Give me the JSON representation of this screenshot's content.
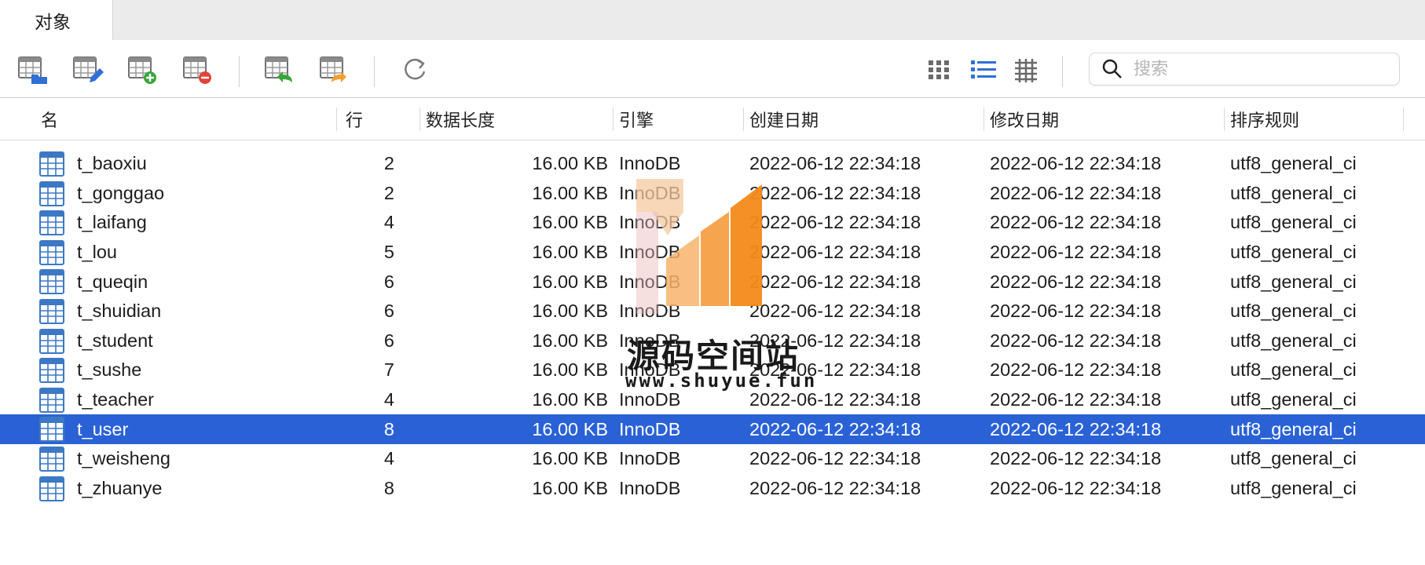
{
  "tabs": [
    {
      "label": "对象",
      "active": true
    }
  ],
  "toolbar": {
    "buttons": [
      "open-table-icon",
      "design-table-icon",
      "new-table-icon",
      "delete-table-icon",
      "import-wizard-icon",
      "export-wizard-icon",
      "refresh-icon"
    ],
    "views": [
      "grid-view-icon",
      "list-view-icon",
      "detail-view-icon"
    ],
    "search_placeholder": "搜索",
    "search_value": ""
  },
  "columns": [
    "名",
    "行",
    "数据长度",
    "引擎",
    "创建日期",
    "修改日期",
    "排序规则"
  ],
  "rows": [
    {
      "name": "t_baoxiu",
      "rows": "2",
      "length": "16.00 KB",
      "engine": "InnoDB",
      "created": "2022-06-12 22:34:18",
      "modified": "2022-06-12 22:34:18",
      "collation": "utf8_general_ci"
    },
    {
      "name": "t_gonggao",
      "rows": "2",
      "length": "16.00 KB",
      "engine": "InnoDB",
      "created": "2022-06-12 22:34:18",
      "modified": "2022-06-12 22:34:18",
      "collation": "utf8_general_ci"
    },
    {
      "name": "t_laifang",
      "rows": "4",
      "length": "16.00 KB",
      "engine": "InnoDB",
      "created": "2022-06-12 22:34:18",
      "modified": "2022-06-12 22:34:18",
      "collation": "utf8_general_ci"
    },
    {
      "name": "t_lou",
      "rows": "5",
      "length": "16.00 KB",
      "engine": "InnoDB",
      "created": "2022-06-12 22:34:18",
      "modified": "2022-06-12 22:34:18",
      "collation": "utf8_general_ci"
    },
    {
      "name": "t_queqin",
      "rows": "6",
      "length": "16.00 KB",
      "engine": "InnoDB",
      "created": "2022-06-12 22:34:18",
      "modified": "2022-06-12 22:34:18",
      "collation": "utf8_general_ci"
    },
    {
      "name": "t_shuidian",
      "rows": "6",
      "length": "16.00 KB",
      "engine": "InnoDB",
      "created": "2022-06-12 22:34:18",
      "modified": "2022-06-12 22:34:18",
      "collation": "utf8_general_ci"
    },
    {
      "name": "t_student",
      "rows": "6",
      "length": "16.00 KB",
      "engine": "InnoDB",
      "created": "2022-06-12 22:34:18",
      "modified": "2022-06-12 22:34:18",
      "collation": "utf8_general_ci"
    },
    {
      "name": "t_sushe",
      "rows": "7",
      "length": "16.00 KB",
      "engine": "InnoDB",
      "created": "2022-06-12 22:34:18",
      "modified": "2022-06-12 22:34:18",
      "collation": "utf8_general_ci"
    },
    {
      "name": "t_teacher",
      "rows": "4",
      "length": "16.00 KB",
      "engine": "InnoDB",
      "created": "2022-06-12 22:34:18",
      "modified": "2022-06-12 22:34:18",
      "collation": "utf8_general_ci"
    },
    {
      "name": "t_user",
      "rows": "8",
      "length": "16.00 KB",
      "engine": "InnoDB",
      "created": "2022-06-12 22:34:18",
      "modified": "2022-06-12 22:34:18",
      "collation": "utf8_general_ci"
    },
    {
      "name": "t_weisheng",
      "rows": "4",
      "length": "16.00 KB",
      "engine": "InnoDB",
      "created": "2022-06-12 22:34:18",
      "modified": "2022-06-12 22:34:18",
      "collation": "utf8_general_ci"
    },
    {
      "name": "t_zhuanye",
      "rows": "8",
      "length": "16.00 KB",
      "engine": "InnoDB",
      "created": "2022-06-12 22:34:18",
      "modified": "2022-06-12 22:34:18",
      "collation": "utf8_general_ci"
    }
  ],
  "selected_row": "t_user",
  "watermark": {
    "title": "源码空间站",
    "url": "www.shuyue.fun"
  },
  "colors": {
    "selection": "#2a62d6",
    "table_icon": "#3d78c4",
    "accent_blue": "#2f6fd6"
  }
}
